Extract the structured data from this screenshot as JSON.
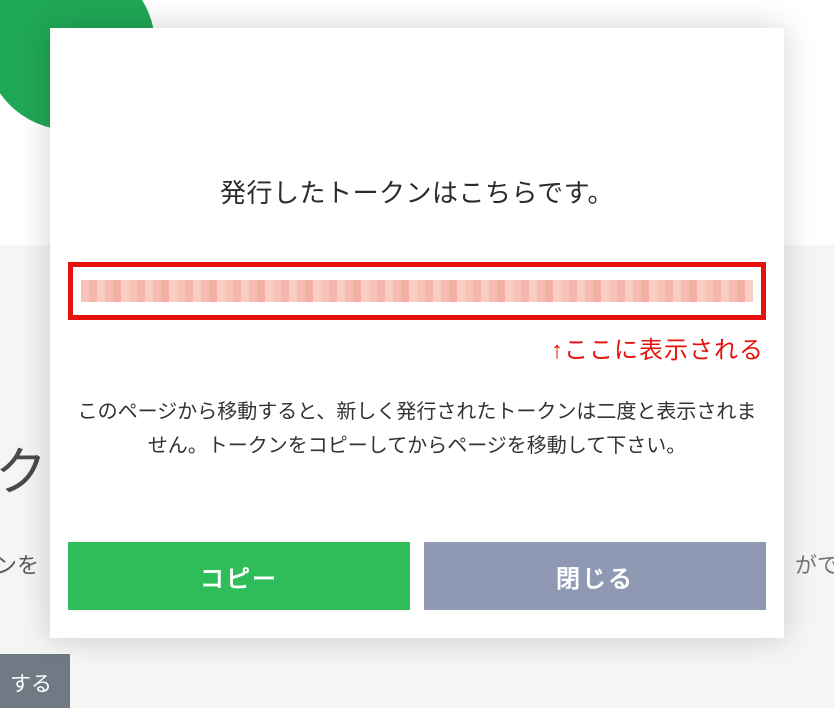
{
  "modal": {
    "title": "発行したトークンはこちらです。",
    "message": "このページから移動すると、新しく発行されたトークンは二度と表示されません。トークンをコピーしてからページを移動して下さい。",
    "buttons": {
      "copy": "コピー",
      "close": "閉じる"
    }
  },
  "annotation": {
    "text": "↑ここに表示される",
    "color": "#e7120e"
  },
  "background": {
    "fragment_ku": "ク",
    "fragment_nwo": "ンを",
    "fragment_gade": "がで",
    "fragment_button": "する"
  }
}
